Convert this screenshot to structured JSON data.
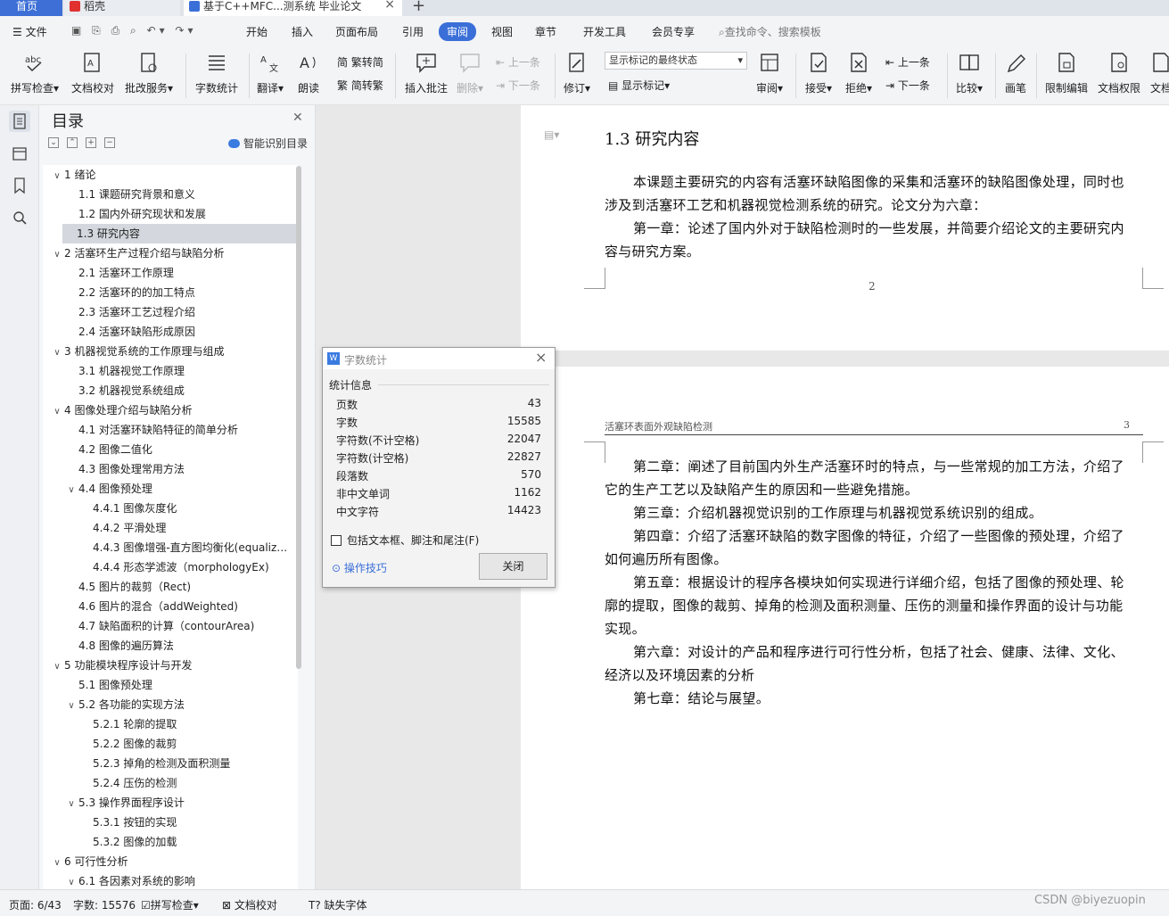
{
  "tabs": {
    "home": "首页",
    "daoke": "稻壳",
    "doc": "基于C++MFC...测系统 毕业论文"
  },
  "menu": {
    "file": "文件",
    "items": [
      "开始",
      "插入",
      "页面布局",
      "引用",
      "审阅",
      "视图",
      "章节",
      "开发工具",
      "会员专享"
    ],
    "active": "审阅",
    "search": "查找命令、搜索模板"
  },
  "ribbon": {
    "spell": "拼写检查",
    "proof": "文档校对",
    "batch": "批改服务",
    "wordcount": "字数统计",
    "translate": "翻译",
    "read": "朗读",
    "trad2simp": "繁转简",
    "simp2trad": "简转繁",
    "insert_comment": "插入批注",
    "delete": "删除",
    "prev": "上一条",
    "next": "下一条",
    "revise": "修订",
    "markup_select": "显示标记的最终状态",
    "show_markup": "显示标记",
    "review": "审阅",
    "accept": "接受",
    "reject": "拒绝",
    "prev2": "上一条",
    "next2": "下一条",
    "compare": "比较",
    "pen": "画笔",
    "restrict": "限制编辑",
    "perm": "文档权限",
    "docx": "文档"
  },
  "toc": {
    "title": "目录",
    "smart": "智能识别目录",
    "items": [
      {
        "text": "1  绪论",
        "level": 0,
        "expanded": true
      },
      {
        "text": "1.1  课题研究背景和意义",
        "level": 1
      },
      {
        "text": "1.2 国内外研究现状和发展",
        "level": 1
      },
      {
        "text": "1.3 研究内容",
        "level": 1,
        "selected": true
      },
      {
        "text": "2  活塞环生产过程介绍与缺陷分析",
        "level": 0,
        "expanded": true
      },
      {
        "text": "2.1 活塞环工作原理",
        "level": 1
      },
      {
        "text": "2.2 活塞环的的加工特点",
        "level": 1
      },
      {
        "text": "2.3 活塞环工艺过程介绍",
        "level": 1
      },
      {
        "text": "2.4 活塞环缺陷形成原因",
        "level": 1
      },
      {
        "text": "3  机器视觉系统的工作原理与组成",
        "level": 0,
        "expanded": true
      },
      {
        "text": "3.1 机器视觉工作原理",
        "level": 1
      },
      {
        "text": "3.2 机器视觉系统组成",
        "level": 1
      },
      {
        "text": "4  图像处理介绍与缺陷分析",
        "level": 0,
        "expanded": true
      },
      {
        "text": "4.1 对活塞环缺陷特征的简单分析",
        "level": 1
      },
      {
        "text": "4.2 图像二值化",
        "level": 1
      },
      {
        "text": "4.3 图像处理常用方法",
        "level": 1
      },
      {
        "text": "4.4 图像预处理",
        "level": 1,
        "expanded": true
      },
      {
        "text": "4.4.1 图像灰度化",
        "level": 2
      },
      {
        "text": "4.4.2 平滑处理",
        "level": 2
      },
      {
        "text": "4.4.3 图像增强-直方图均衡化(equaliz…",
        "level": 2
      },
      {
        "text": "4.4.4 形态学滤波（morphologyEx)",
        "level": 2
      },
      {
        "text": "4.5 图片的裁剪（Rect)",
        "level": 1
      },
      {
        "text": "4.6 图片的混合（addWeighted)",
        "level": 1
      },
      {
        "text": "4.7 缺陷面积的计算（contourArea)",
        "level": 1
      },
      {
        "text": "4.8 图像的遍历算法",
        "level": 1
      },
      {
        "text": "5  功能模块程序设计与开发",
        "level": 0,
        "expanded": true
      },
      {
        "text": "5.1 图像预处理",
        "level": 1
      },
      {
        "text": "5.2 各功能的实现方法",
        "level": 1,
        "expanded": true
      },
      {
        "text": "5.2.1 轮廓的提取",
        "level": 2
      },
      {
        "text": "5.2.2 图像的裁剪",
        "level": 2
      },
      {
        "text": "5.2.3 掉角的检测及面积测量",
        "level": 2
      },
      {
        "text": "5.2.4 压伤的检测",
        "level": 2
      },
      {
        "text": "5.3 操作界面程序设计",
        "level": 1,
        "expanded": true
      },
      {
        "text": "5.3.1 按钮的实现",
        "level": 2
      },
      {
        "text": "5.3.2 图像的加载",
        "level": 2
      },
      {
        "text": "6  可行性分析",
        "level": 0,
        "expanded": true
      },
      {
        "text": "6.1 各因素对系统的影响",
        "level": 1,
        "expanded": true
      }
    ]
  },
  "doc": {
    "heading": "1.3 研究内容",
    "page1_paras": [
      "本课题主要研究的内容有活塞环缺陷图像的采集和活塞环的缺陷图像处理，同时也",
      "涉及到活塞环工艺和机器视觉检测系统的研究。论文分为六章：",
      "第一章：论述了国内外对于缺陷检测时的一些发展，并简要介绍论文的主要研究内",
      "容与研究方案。"
    ],
    "page1_number": "2",
    "page2_header": "活塞环表面外观缺陷检测",
    "page2_number": "3",
    "page2_paras": [
      "第二章：阐述了目前国内外生产活塞环时的特点，与一些常规的加工方法，介绍了",
      "它的生产工艺以及缺陷产生的原因和一些避免措施。",
      "第三章：介绍机器视觉识别的工作原理与机器视觉系统识别的组成。",
      "第四章：介绍了活塞环缺陷的数字图像的特征，介绍了一些图像的预处理，介绍了",
      "如何遍历所有图像。",
      "第五章：根据设计的程序各模块如何实现进行详细介绍，包括了图像的预处理、轮",
      "廓的提取，图像的裁剪、掉角的检测及面积测量、压伤的测量和操作界面的设计与功能",
      "实现。",
      "第六章：对设计的产品和程序进行可行性分析，包括了社会、健康、法律、文化、",
      "经济以及环境因素的分析",
      "第七章：结论与展望。"
    ]
  },
  "dialog": {
    "title": "字数统计",
    "group": "统计信息",
    "rows": [
      {
        "label": "页数",
        "value": "43"
      },
      {
        "label": "字数",
        "value": "15585"
      },
      {
        "label": "字符数(不计空格)",
        "value": "22047"
      },
      {
        "label": "字符数(计空格)",
        "value": "22827"
      },
      {
        "label": "段落数",
        "value": "570"
      },
      {
        "label": "非中文单词",
        "value": "1162"
      },
      {
        "label": "中文字符",
        "value": "14423"
      }
    ],
    "checkbox": "包括文本框、脚注和尾注(F)",
    "tips": "操作技巧",
    "close": "关闭"
  },
  "status": {
    "page": "页面: 6/43",
    "words": "字数: 15576",
    "spell": "拼写检查",
    "proof": "文档校对",
    "missing_font": "缺失字体",
    "watermark": "CSDN @biyezuopin"
  },
  "colors": {
    "accent": "#3a6fd8",
    "tab_home": "#3d6fd6",
    "daoke_red": "#e0312f"
  }
}
